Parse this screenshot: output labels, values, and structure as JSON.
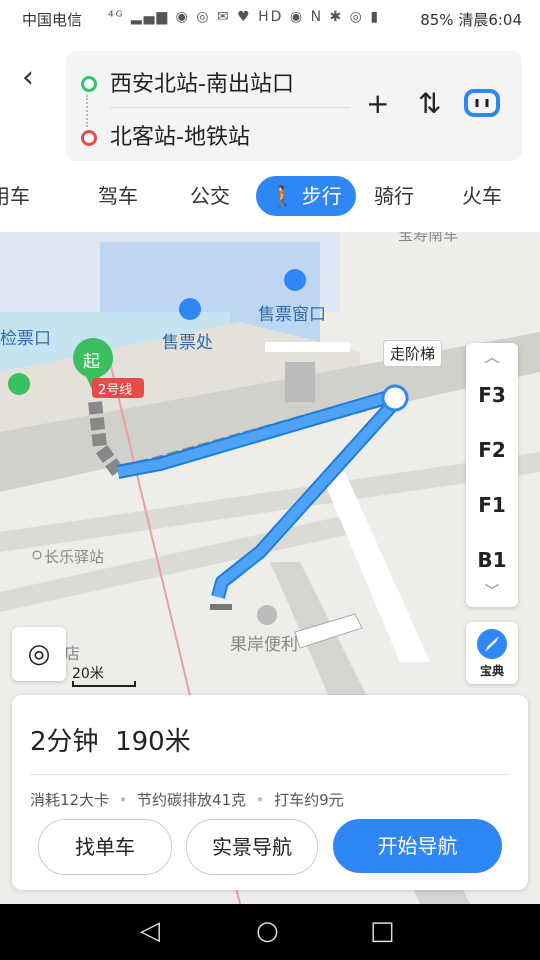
{
  "status": {
    "carrier": "中国电信",
    "icons": "⁴ᴳ ▂▄▆ ◉ ◎ ✉ ♥ HD ◉ N ✱ ◎ ▮",
    "battery": "85%",
    "time": "清晨6:04"
  },
  "route": {
    "from": "西安北站-南出站口",
    "to": "北客站-地铁站",
    "add": "+",
    "swap": "⇅"
  },
  "tabs": [
    "用车",
    "驾车",
    "公交",
    "步行",
    "骑行",
    "火车"
  ],
  "map": {
    "labels": {
      "ticket_office": "售票处",
      "ticket_window": "售票窗口",
      "check_gate": "检票口",
      "line": "2号线",
      "start": "起",
      "stair": "走阶梯",
      "station": "长乐驿站",
      "shop": "果岸便利",
      "store": "店",
      "top": "宝寿南车"
    },
    "floors": [
      "F3",
      "F2",
      "F1",
      "B1"
    ],
    "baodian": "宝典",
    "scale": "20米"
  },
  "summary": {
    "time": "2分钟",
    "distance": "190米",
    "calorie": "消耗12大卡",
    "carbon": "节约碳排放41克",
    "taxi": "打车约9元"
  },
  "buttons": {
    "bike": "找单车",
    "ar": "实景导航",
    "start": "开始导航"
  },
  "colors": {
    "accent": "#2f86f5",
    "start": "#2fc46b",
    "end": "#e84a4a"
  }
}
